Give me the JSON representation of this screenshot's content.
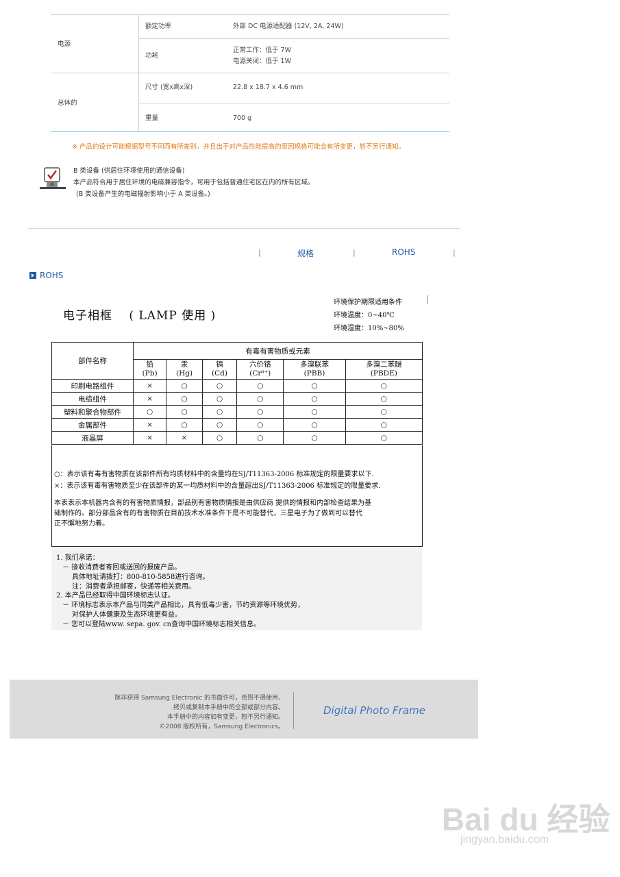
{
  "spec": {
    "power": {
      "category": "电源",
      "rated_label": "额定功率",
      "rated_value": "外部 DC 电源适配器 (12V, 2A, 24W)",
      "consumption_label": "功耗",
      "consumption_normal": "正常工作：低于 7W",
      "consumption_off": "电源关闭：低于 1W"
    },
    "general": {
      "category": "总体的",
      "size_label": "尺寸 (宽x高x深)",
      "size_value": "22.8 x 18.7 x 4.6 mm",
      "weight_label": "重量",
      "weight_value": "700 g"
    }
  },
  "notice": "※ 产品的设计可能根据型号不同而有所差别，并且出于对产品性能提高的原因规格可能会有所变更，恕不另行通知。",
  "class_b": {
    "title": "B 类设备 (供居住环境使用的通信设备)",
    "line1": "本产品符合用于居住环境的电磁兼容指令，可用于包括普通住宅区在内的所有区域。",
    "line2": "(B 类设备产生的电磁辐射影响小于 A 类设备。)"
  },
  "nav": {
    "sep": "|",
    "spec_link": "规格",
    "rohs_link": "ROHS"
  },
  "section_title": "ROHS",
  "rohs_doc": {
    "title": "电子相框　 ( LAMP 使用 )",
    "env_line1": "环境保护期限适用条件",
    "env_line2": "环境温度：0~40℃",
    "env_line3": "环境湿度：10%~80%",
    "header_part": "部件名称",
    "header_group": "有毒有害物质或元素",
    "columns": [
      {
        "name": "铅",
        "symbol": "(Pb)"
      },
      {
        "name": "汞",
        "symbol": "(Hg)"
      },
      {
        "name": "镉",
        "symbol": "(Cd)"
      },
      {
        "name": "六价铬",
        "symbol": "(Cr⁶⁺)"
      },
      {
        "name": "多溴联苯",
        "symbol": "(PBB)"
      },
      {
        "name": "多溴二苯醚",
        "symbol": "(PBDE)"
      }
    ],
    "rows": [
      {
        "part": "印刷电路组件",
        "marks": [
          "×",
          "○",
          "○",
          "○",
          "○",
          "○"
        ]
      },
      {
        "part": "电缆组件",
        "marks": [
          "×",
          "○",
          "○",
          "○",
          "○",
          "○"
        ]
      },
      {
        "part": "塑料和聚合物部件",
        "marks": [
          "○",
          "○",
          "○",
          "○",
          "○",
          "○"
        ]
      },
      {
        "part": "金属部件",
        "marks": [
          "×",
          "○",
          "○",
          "○",
          "○",
          "○"
        ]
      },
      {
        "part": "液晶屏",
        "marks": [
          "×",
          "×",
          "○",
          "○",
          "○",
          "○"
        ]
      }
    ],
    "note_o": "○：表示该有毒有害物质在该部件所有均质材料中的含量均在SJ/T11363-2006 标准规定的限量要求以下.",
    "note_x": "×：表示该有毒有害物质至少在该部件的某一均质材料中的含量超出SJ/T11363-2006 标准规定的限量要求.",
    "note_p1": "本表表示本机器内含有的有害物质情报，部品别有害物质情报是由供应商 提供的情报和内部检查结果为基",
    "note_p2": "础制作的。部分部品含有的有害物质在目前技术水准条件下是不可能替代，三星电子为了做到可以替代",
    "note_p3": "正不懈地努力着。"
  },
  "promise": {
    "l1": "1. 我们承诺：",
    "l2": "－ 接收消费者寄回或送回的报废产品。",
    "l3": "具体地址请拨打：800-810-5858进行咨询。",
    "l4": "注：消费者承担邮寄，快递等相关费用。",
    "l5": "2. 本产品已经取得中国环境标志认证。",
    "l6": "－ 环境标志表示本产品与同类产品相比，具有低毒少害，节约资源等环境优势，",
    "l7": "对保护人体健康及生态环境更有益。",
    "l8": "－ 您可以登陆www. sepa. gov. cn查询中国环境标志相关信息。"
  },
  "footer": {
    "c1": "除非获得 Samsung Electronic 的书面许可，否则不得使用、",
    "c2": "拷贝或复制本手册中的全部或部分内容。",
    "c3": "本手册中的内容如有变更，恕不另行通知。",
    "c4": "©2008 版权所有，Samsung Electronics。",
    "brand": "Digital Photo Frame"
  },
  "watermark": {
    "logo": "Bai du 经验",
    "url": "jingyan.baidu.com"
  }
}
